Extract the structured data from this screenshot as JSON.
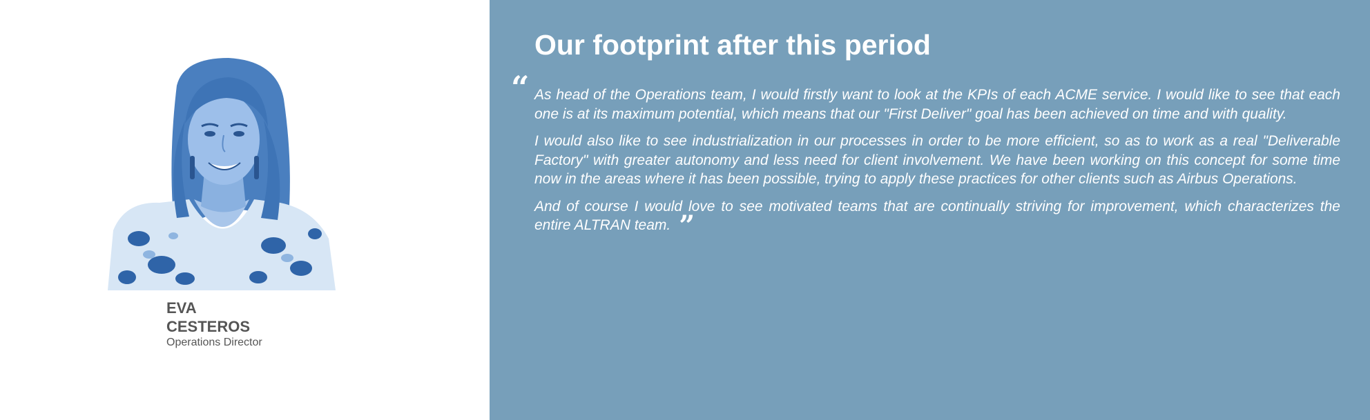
{
  "person": {
    "first_name": "EVA",
    "last_name": "CESTEROS",
    "role": "Operations Director"
  },
  "section": {
    "title": "Our footprint after this period"
  },
  "quote": {
    "paragraphs": [
      "As head of the Operations team, I would firstly want to look at the KPIs of each ACME service. I would like to see that each one is at its maximum potential, which means that our \"First Deliver\" goal has been achieved on time and with quality.",
      "I would also like to see industrialization in our processes in order to be more efficient, so as to work as a real \"Deliverable Factory\" with greater autonomy and less need for client involvement. We have been working on this concept for some time now in the areas where it has been possible, trying to apply these practices for other clients such as Airbus Operations.",
      "And of course I would love to see motivated teams that are continually striving for improvement, which characterizes the entire ALTRAN team."
    ],
    "open_mark": "“",
    "close_mark": "”"
  },
  "colors": {
    "panel_background": "#779fba",
    "portrait_tint": "#5b8fc7",
    "name_text": "#555555"
  }
}
